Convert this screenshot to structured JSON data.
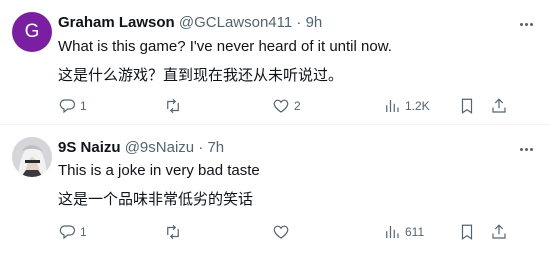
{
  "tweets": [
    {
      "avatar_letter": "G",
      "avatar_color": "#7b1fa2",
      "name": "Graham Lawson",
      "handle": "@GCLawson411",
      "time": "9h",
      "text_en": "What is this game? I've never heard of it until now.",
      "text_zh": "这是什么游戏？直到现在我还从未听说过。",
      "replies": "1",
      "retweets": "",
      "likes": "2",
      "views": "1.2K"
    },
    {
      "avatar_letter": "",
      "avatar_color": "#d9d9dc",
      "name": "9S Naizu",
      "handle": "@9sNaizu",
      "time": "7h",
      "text_en": "This is a joke in very bad taste",
      "text_zh": "这是一个品味非常低劣的笑话",
      "replies": "1",
      "retweets": "",
      "likes": "",
      "views": "611"
    }
  ],
  "separator": "·"
}
